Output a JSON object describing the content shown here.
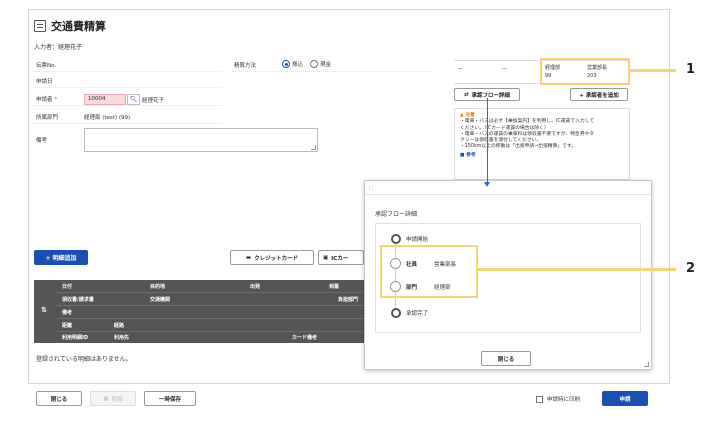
{
  "header": {
    "title": "交通費精算",
    "entrant_label": "入力者：経理花子"
  },
  "form": {
    "slip_no_label": "伝票No.",
    "apply_date_label": "申請日",
    "applicant_label": "申請者",
    "required_mark": "*",
    "applicant_code": "10004",
    "applicant_name": "経理花子",
    "dept_label": "所属部門",
    "dept_value": "経理部 (test) (99)",
    "remarks_label": "備考",
    "settle_method_label": "精算方法",
    "settle_options": [
      "振込",
      "現金"
    ],
    "settle_selected": "振込"
  },
  "approval": {
    "dash1": "—",
    "dash2": "—",
    "dept_name": "経理部",
    "dept_code": "99",
    "manager_title": "営業部長",
    "manager_code": "203",
    "flow_detail_button": "承認フロー詳細",
    "add_approver_button": "+ 承認者を追加"
  },
  "notice": {
    "heading": "注意",
    "lines": [
      "・電車・バスは必ず【乗換案内】を利用し、IC運賃で入力して",
      "ください。（ICカード運賃の場合は除く）",
      "・電車・バスの運賃の乗車料は領収書不要ですが、特急券やタ",
      "クシーは領収書を添付してください。",
      "・150km以上の移動は「出張申請→出張精算」です。"
    ],
    "ref": "参考"
  },
  "details": {
    "add_button": "+ 明細追加",
    "credit_button": "クレジットカード",
    "ic_button": "ICカー",
    "headers": {
      "date": "日付",
      "destination": "目的地",
      "departure": "出発",
      "arrival": "到着",
      "receipt": "領収書/請求書",
      "transport": "交通機関",
      "burden_dept": "負担部門",
      "remarks": "備考",
      "distance": "距離",
      "route": "経路",
      "usage_id": "利用明細ID",
      "usage_dest": "利用先",
      "card_remarks": "カード備考"
    },
    "empty_message": "登録されている明細はありません。"
  },
  "modal": {
    "title": "承認フロー詳細",
    "steps": [
      {
        "label": "申請開始"
      },
      {
        "role": "社員",
        "name": "営業部長"
      },
      {
        "role": "部門",
        "name": "経理部"
      },
      {
        "label": "承認完了"
      }
    ],
    "close_button": "閉じる"
  },
  "footer": {
    "close": "閉じる",
    "delete": "削除",
    "temp_save": "一時保存",
    "print_on_apply": "申請時に印刷",
    "apply": "申請"
  },
  "callouts": {
    "one": "1",
    "two": "2"
  },
  "colors": {
    "primary": "#1a4fb4",
    "highlight": "#f2d675",
    "required_bg": "#fadadd"
  }
}
